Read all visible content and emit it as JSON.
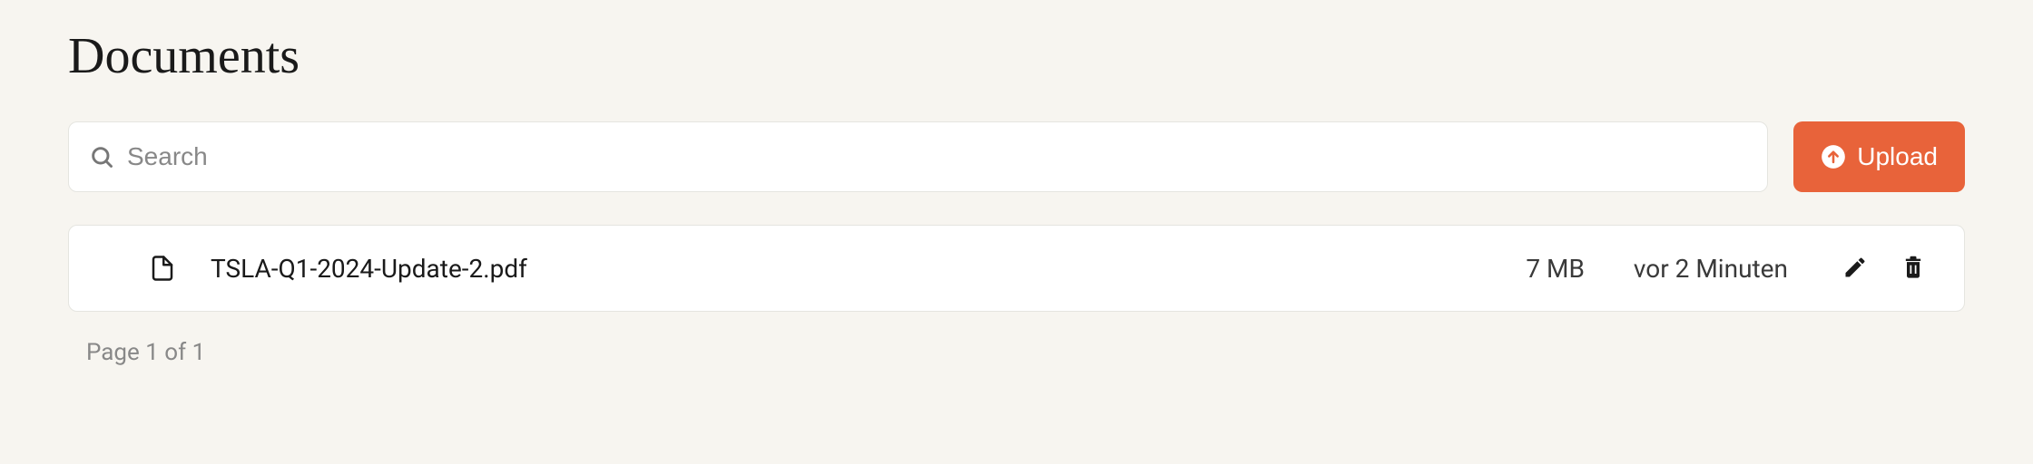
{
  "header": {
    "title": "Documents"
  },
  "search": {
    "placeholder": "Search",
    "value": ""
  },
  "upload": {
    "label": "Upload"
  },
  "documents": [
    {
      "name": "TSLA-Q1-2024-Update-2.pdf",
      "size": "7 MB",
      "modified": "vor 2 Minuten"
    }
  ],
  "pagination": {
    "label": "Page 1 of 1"
  }
}
